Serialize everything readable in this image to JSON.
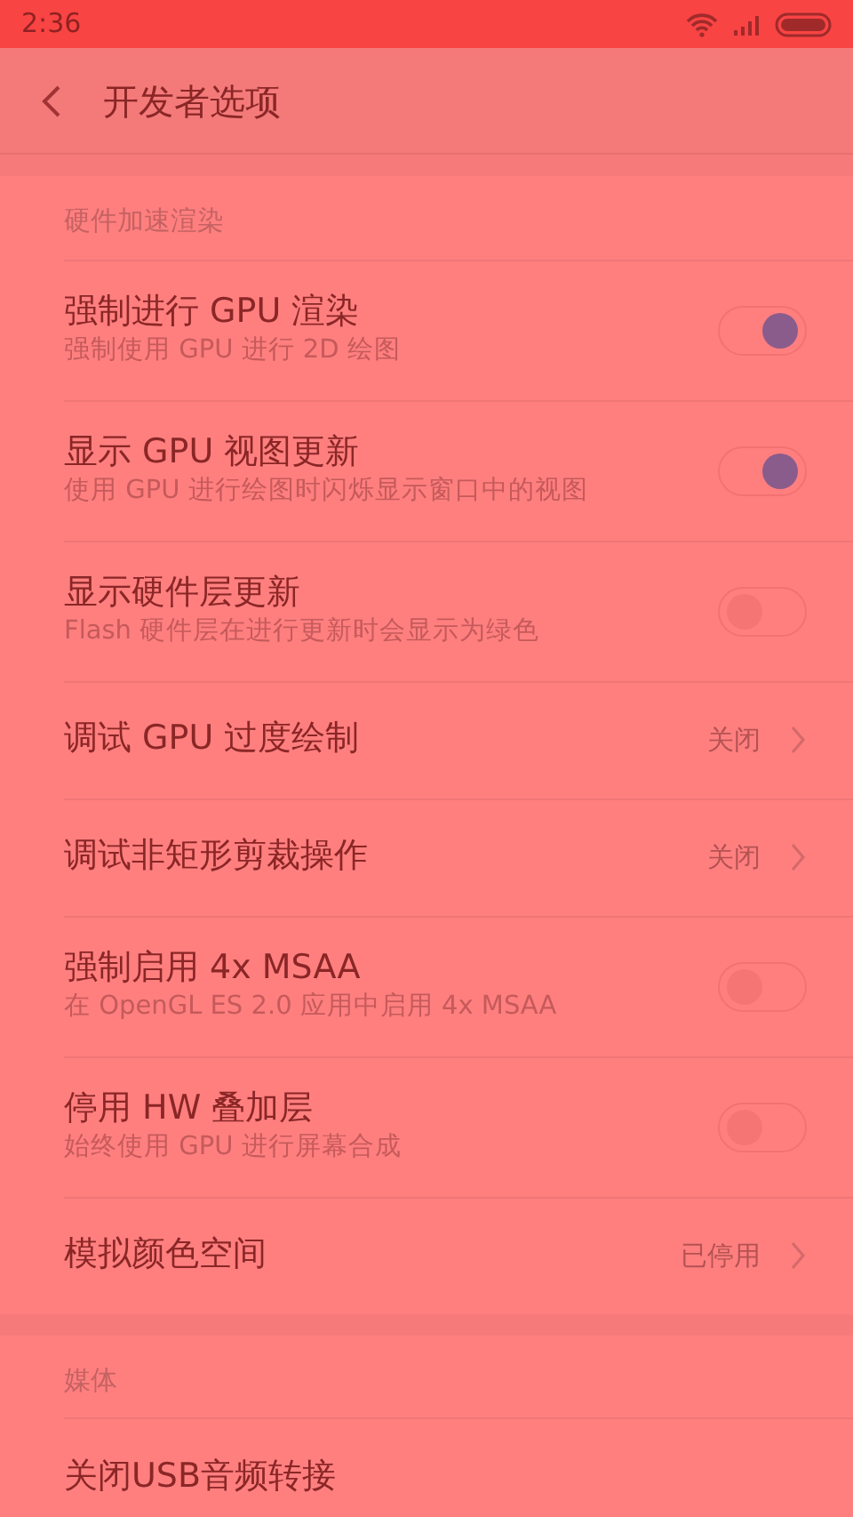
{
  "status_bar": {
    "time": "2:36"
  },
  "header": {
    "title": "开发者选项"
  },
  "sections": [
    {
      "title": "硬件加速渲染",
      "items": [
        {
          "kind": "toggle",
          "title": "强制进行 GPU 渲染",
          "subtitle": "强制使用 GPU 进行 2D 绘图",
          "on": true
        },
        {
          "kind": "toggle",
          "title": "显示 GPU 视图更新",
          "subtitle": "使用 GPU 进行绘图时闪烁显示窗口中的视图",
          "on": true
        },
        {
          "kind": "toggle",
          "title": "显示硬件层更新",
          "subtitle": "Flash 硬件层在进行更新时会显示为绿色",
          "on": false
        },
        {
          "kind": "link",
          "title": "调试 GPU 过度绘制",
          "value": "关闭"
        },
        {
          "kind": "link",
          "title": "调试非矩形剪裁操作",
          "value": "关闭"
        },
        {
          "kind": "toggle",
          "title": "强制启用 4x MSAA",
          "subtitle": "在 OpenGL ES 2.0 应用中启用 4x MSAA",
          "on": false
        },
        {
          "kind": "toggle",
          "title": "停用 HW 叠加层",
          "subtitle": "始终使用 GPU 进行屏幕合成",
          "on": false
        },
        {
          "kind": "link",
          "title": "模拟颜色空间",
          "value": "已停用"
        }
      ]
    },
    {
      "title": "媒体",
      "items": [
        {
          "kind": "plain",
          "title": "关闭USB音频转接"
        }
      ]
    }
  ]
}
